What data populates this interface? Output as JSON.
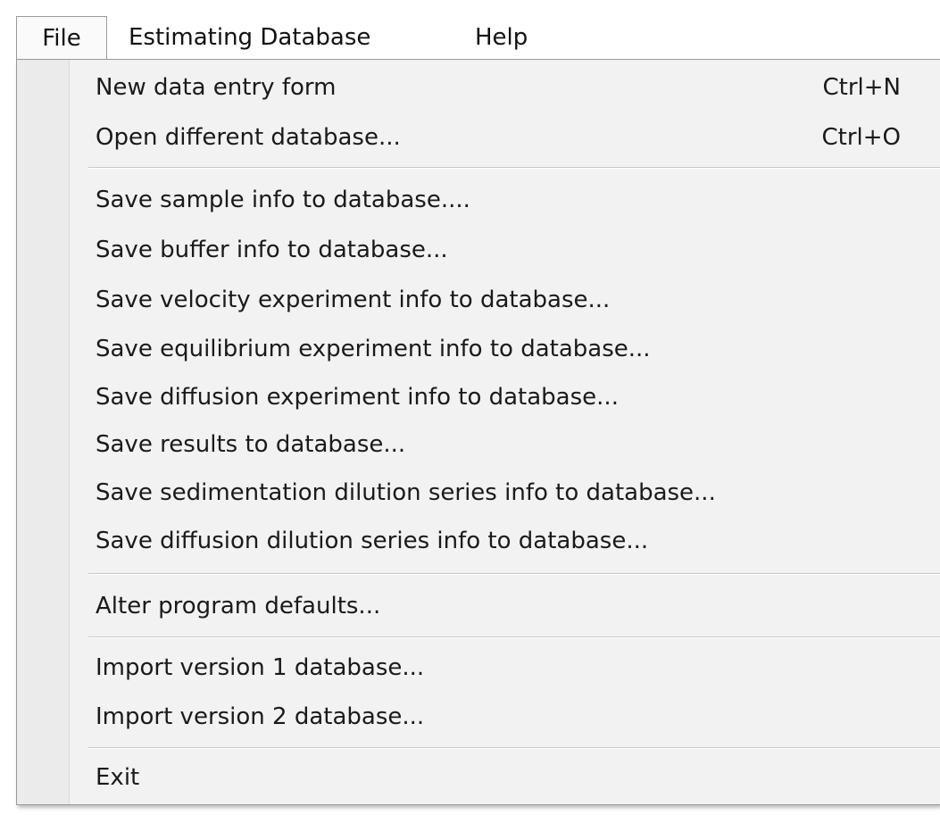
{
  "menubar": {
    "file": "File",
    "estimating_database": "Estimating Database",
    "help": "Help"
  },
  "file_menu": {
    "items": [
      {
        "label": "New data entry form",
        "shortcut": "Ctrl+N"
      },
      {
        "label": "Open different database...",
        "shortcut": "Ctrl+O"
      },
      {
        "label": "Save sample info to database...."
      },
      {
        "label": "Save buffer info to database..."
      },
      {
        "label": "Save velocity experiment info to database..."
      },
      {
        "label": "Save equilibrium experiment info to database..."
      },
      {
        "label": "Save diffusion experiment info to database..."
      },
      {
        "label": "Save results to database..."
      },
      {
        "label": "Save sedimentation dilution series info to database..."
      },
      {
        "label": "Save diffusion dilution series info to database..."
      },
      {
        "label": "Alter program defaults..."
      },
      {
        "label": "Import version 1 database..."
      },
      {
        "label": "Import version 2 database..."
      },
      {
        "label": "Exit"
      }
    ]
  }
}
